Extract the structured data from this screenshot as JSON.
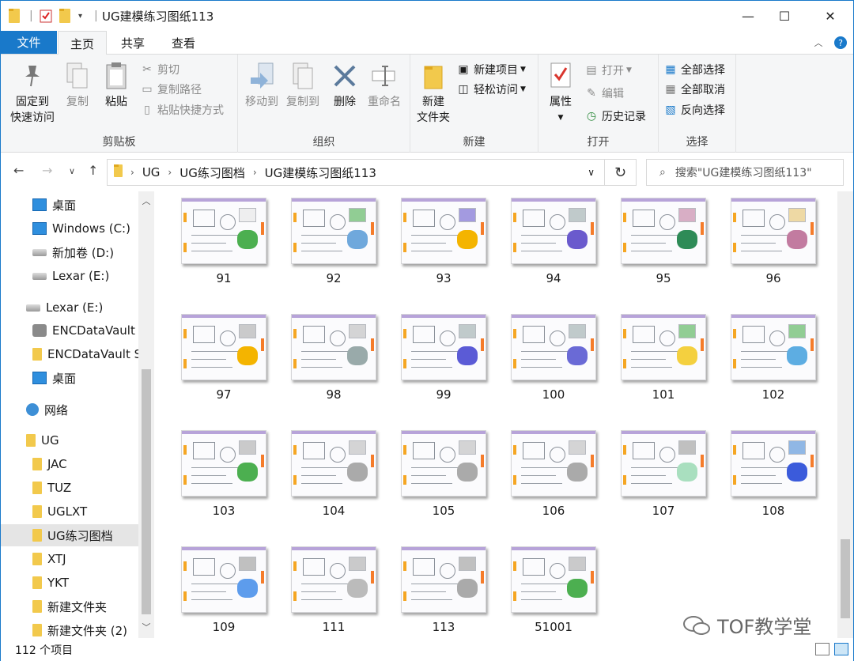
{
  "window": {
    "title": "UG建模练习图纸113",
    "controls": {
      "minimize": "—",
      "maximize": "☐",
      "close": "✕"
    }
  },
  "ribbon_tabs": {
    "file": "文件",
    "home": "主页",
    "share": "共享",
    "view": "查看"
  },
  "ribbon": {
    "clipboard": {
      "label": "剪贴板",
      "pin_line1": "固定到",
      "pin_line2": "快速访问",
      "copy": "复制",
      "paste": "粘贴",
      "cut": "剪切",
      "copy_path": "复制路径",
      "paste_shortcut": "粘贴快捷方式"
    },
    "organize": {
      "label": "组织",
      "move_to": "移动到",
      "copy_to": "复制到",
      "delete": "删除",
      "rename": "重命名"
    },
    "new": {
      "label": "新建",
      "new_folder_line1": "新建",
      "new_folder_line2": "文件夹",
      "new_item": "新建项目",
      "easy_access": "轻松访问"
    },
    "open": {
      "label": "打开",
      "properties": "属性",
      "open": "打开",
      "edit": "编辑",
      "history": "历史记录"
    },
    "select": {
      "label": "选择",
      "select_all": "全部选择",
      "select_none": "全部取消",
      "invert": "反向选择"
    }
  },
  "address": {
    "segments": [
      "UG",
      "UG练习图档",
      "UG建模练习图纸113"
    ],
    "search_placeholder": "搜索\"UG建模练习图纸113\""
  },
  "nav_items": [
    {
      "label": "桌面",
      "icon": "desktop-icon"
    },
    {
      "label": "Windows (C:)",
      "icon": "windows-drive-icon"
    },
    {
      "label": "新加卷 (D:)",
      "icon": "drive-icon"
    },
    {
      "label": "Lexar (E:)",
      "icon": "drive-icon"
    },
    {
      "label": "Lexar (E:)",
      "icon": "drive-icon"
    },
    {
      "label": "ENCDataVault",
      "icon": "vault-icon"
    },
    {
      "label": "ENCDataVault S",
      "icon": "folder-icon"
    },
    {
      "label": "桌面",
      "icon": "desktop-icon"
    },
    {
      "label": "网络",
      "icon": "network-icon"
    },
    {
      "label": "UG",
      "icon": "folder-icon"
    },
    {
      "label": "JAC",
      "icon": "folder-icon"
    },
    {
      "label": "TUZ",
      "icon": "folder-icon"
    },
    {
      "label": "UGLXT",
      "icon": "folder-icon"
    },
    {
      "label": "UG练习图档",
      "icon": "folder-icon"
    },
    {
      "label": "XTJ",
      "icon": "folder-icon"
    },
    {
      "label": "YKT",
      "icon": "folder-icon"
    },
    {
      "label": "新建文件夹",
      "icon": "folder-icon"
    },
    {
      "label": "新建文件夹 (2)",
      "icon": "folder-icon"
    }
  ],
  "files": [
    "91",
    "92",
    "93",
    "94",
    "95",
    "96",
    "97",
    "98",
    "99",
    "100",
    "101",
    "102",
    "103",
    "104",
    "105",
    "106",
    "107",
    "108",
    "109",
    "111",
    "113",
    "51001"
  ],
  "status": {
    "count": "112 个项目"
  },
  "watermark": "TOF教学堂",
  "colors": {
    "accent": "#1979ca",
    "ribbon_bg": "#f5f6f7",
    "selected_bg": "#e5e5e5"
  }
}
